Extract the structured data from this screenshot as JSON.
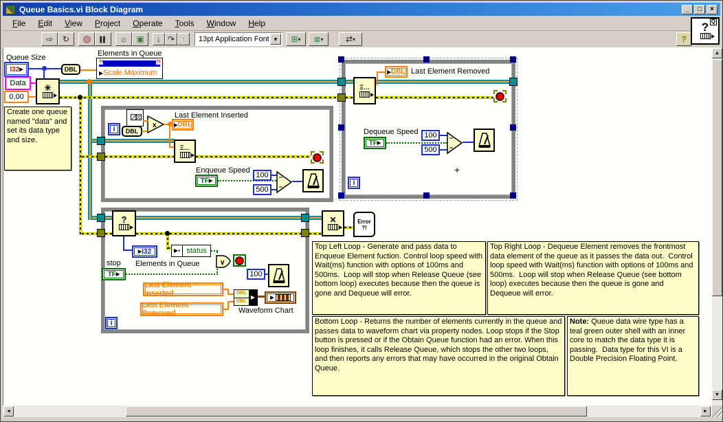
{
  "window": {
    "title": "Queue Basics.vi Block Diagram",
    "min": "_",
    "max": "□",
    "close": "×"
  },
  "menu": {
    "items": [
      "File",
      "Edit",
      "View",
      "Project",
      "Operate",
      "Tools",
      "Window",
      "Help"
    ]
  },
  "toolbar": {
    "font": "13pt Application Font",
    "icons": {
      "run": "⇨",
      "run_continuous": "↻",
      "pause": "▌▌",
      "highlight": "☼",
      "retain": "▣",
      "step_into": "↓",
      "step_over": "↷",
      "step_out": "↑",
      "align": "⊞",
      "distribute": "≣",
      "reorder": "⇄",
      "dropdown": "▾",
      "help": "?"
    },
    "vi_icon": {
      "q": "?",
      "badge": "Q"
    }
  },
  "scroll": {
    "up": "▲",
    "down": "▼",
    "left": "◄",
    "right": "►"
  },
  "colors": {
    "queue_wire": "#009595",
    "queue_core": "#FF9A4D",
    "error_wire": "#E8E800",
    "dbl_orange": "#FF8000",
    "i32_blue": "#2030D0",
    "bool_green": "#007000",
    "string_pink": "#F000F0",
    "loop_gray": "#848484",
    "comment_bg": "#FDFDC8"
  },
  "diagram": {
    "queue_size": {
      "label": "Queue Size",
      "type": "I32"
    },
    "data_const": "Data",
    "size_const": "0,00",
    "coercion": "DBL",
    "obtain_symbol": "✳",
    "property_node": {
      "label": "Elements in Queue",
      "property": "Scale.Maximum"
    },
    "comment_create": "Create one queue named \"data\" and set its data type and size.",
    "loop_top_left": {
      "iter": "i",
      "to_dbl": "DBL",
      "multiply": "x",
      "dice": "⚂⚄",
      "inserted_label": "Last Element Inserted",
      "inserted_type": "DBL",
      "enqueue_symbol": "Ξ…",
      "speed_label": "Enqueue Speed",
      "speed_tf": "TF",
      "wait_fast": "100",
      "wait_slow": "500"
    },
    "loop_top_right": {
      "dequeue_symbol": "Ξ…",
      "removed_label": "Last Element Removed",
      "removed_type": "DBL",
      "speed_label": "Dequeue Speed",
      "speed_tf": "TF",
      "wait_fast": "100",
      "wait_slow": "500",
      "iter": "i"
    },
    "loop_bottom": {
      "status_symbol": "?",
      "elements_type": "I32",
      "elements_label": "Elements in Queue",
      "stop_label": "stop",
      "stop_tf": "TF",
      "unbundle_field": "status",
      "or_symbol": "∨",
      "wait": "100",
      "local_inserted": "Last Element Inserted",
      "local_removed": "Last Element Removed",
      "bundle_top": "DBL",
      "bundle_bottom": "DBL",
      "chart_label": "Waveform Chart",
      "iter": "i"
    },
    "release_symbol": "✕",
    "error_handler": {
      "line1": "Error",
      "line2": "?!"
    },
    "comments": {
      "top_left": "Top Left Loop - Generate and pass data to Enqueue Element fuction. Control loop speed with Wait(ms) function with options of 100ms and 500ms.  Loop will stop when Release Queue (see bottom loop) executes because then the queue is gone and Dequeue will error.",
      "top_right": "Top Right Loop - Dequeue Element removes the frontmost data element of the queue as it passes the data out.  Control loop speed with Wait(ms) function with options of 100ms and 500ms.  Loop will stop when Release Queue (see bottom loop) executes because then the queue is gone and Dequeue will error.",
      "bottom": "Bottom Loop - Returns the number of elements currently in the queue and passes data to waveform chart via property nodes. Loop stops if the Stop button is pressed or if the Obtain Queue function had an error. When this loop finishes, it calls Release Queue, which stops the other two loops, and then reports any errors that may have occurred in the original Obtain Queue.",
      "note_bold": "Note:",
      "note_rest": " Queue data wire type has a teal green outer shell with an inner core to match the data type it is passing.  Data type for this VI is a Double Precision Floating Point."
    }
  }
}
